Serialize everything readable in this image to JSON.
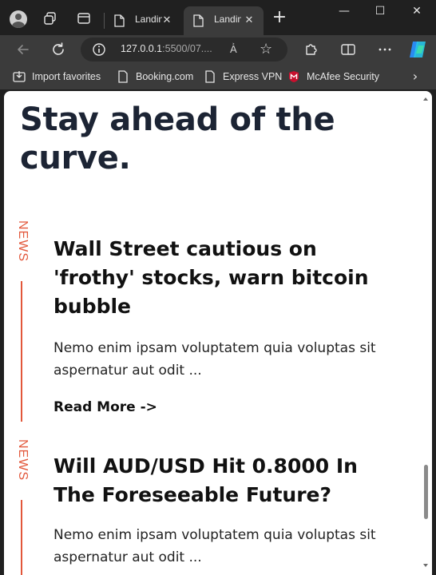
{
  "tabs": [
    {
      "title": "Landing Page",
      "state": "inactive"
    },
    {
      "title": "Landing Page",
      "state": "active"
    }
  ],
  "window_controls": {
    "minimize": "—",
    "maximize": "☐",
    "close": "✕"
  },
  "address_bar": {
    "url_host": "127.0.0.1",
    "url_rest": ":5500/07....",
    "read_aloud": "A͐"
  },
  "favorites": [
    {
      "label": "Import favorites",
      "icon": "import-icon"
    },
    {
      "label": "Booking.com",
      "icon": "page-icon"
    },
    {
      "label": "Express VPN",
      "icon": "page-icon"
    },
    {
      "label": "McAfee Security",
      "icon": "mcafee-icon"
    }
  ],
  "page": {
    "headline": "Stay ahead of the curve.",
    "articles": [
      {
        "category": "NEWS",
        "title": "Wall Street cautious on 'frothy' stocks, warn bitcoin bubble",
        "excerpt": "Nemo enim ipsam voluptatem quia voluptas sit aspernatur aut odit ...",
        "read_more": "Read More ->"
      },
      {
        "category": "NEWS",
        "title": "Will AUD/USD Hit 0.8000 In The Foreseeable Future?",
        "excerpt": "Nemo enim ipsam voluptatem quia voluptas sit aspernatur aut odit ...",
        "read_more": ""
      }
    ]
  },
  "colors": {
    "accent": "#e2573a",
    "headline": "#1c2434",
    "chrome_dark": "#202020",
    "chrome_toolbar": "#3b3b3b"
  }
}
